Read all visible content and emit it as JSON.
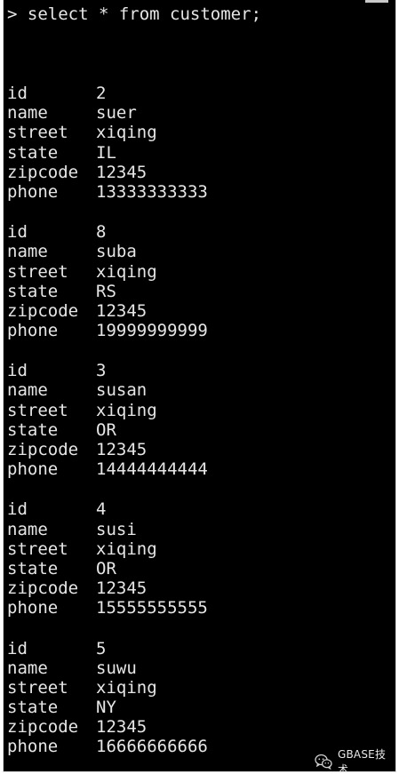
{
  "terminal": {
    "prompt": ">",
    "command": "select * from customer;"
  },
  "records": [
    {
      "fields": [
        {
          "key": "id",
          "value": "2"
        },
        {
          "key": "name",
          "value": "suer"
        },
        {
          "key": "street",
          "value": "xiqing"
        },
        {
          "key": "state",
          "value": "IL"
        },
        {
          "key": "zipcode",
          "value": "12345"
        },
        {
          "key": "phone",
          "value": "13333333333"
        }
      ]
    },
    {
      "fields": [
        {
          "key": "id",
          "value": "8"
        },
        {
          "key": "name",
          "value": "suba"
        },
        {
          "key": "street",
          "value": "xiqing"
        },
        {
          "key": "state",
          "value": "RS"
        },
        {
          "key": "zipcode",
          "value": "12345"
        },
        {
          "key": "phone",
          "value": "19999999999"
        }
      ]
    },
    {
      "fields": [
        {
          "key": "id",
          "value": "3"
        },
        {
          "key": "name",
          "value": "susan"
        },
        {
          "key": "street",
          "value": "xiqing"
        },
        {
          "key": "state",
          "value": "OR"
        },
        {
          "key": "zipcode",
          "value": "12345"
        },
        {
          "key": "phone",
          "value": "14444444444"
        }
      ]
    },
    {
      "fields": [
        {
          "key": "id",
          "value": "4"
        },
        {
          "key": "name",
          "value": "susi"
        },
        {
          "key": "street",
          "value": "xiqing"
        },
        {
          "key": "state",
          "value": "OR"
        },
        {
          "key": "zipcode",
          "value": "12345"
        },
        {
          "key": "phone",
          "value": "15555555555"
        }
      ]
    },
    {
      "fields": [
        {
          "key": "id",
          "value": "5"
        },
        {
          "key": "name",
          "value": "suwu"
        },
        {
          "key": "street",
          "value": "xiqing"
        },
        {
          "key": "state",
          "value": "NY"
        },
        {
          "key": "zipcode",
          "value": "12345"
        },
        {
          "key": "phone",
          "value": "16666666666"
        }
      ]
    }
  ],
  "watermark": {
    "icon": "wechat-icon",
    "text": "GBASE技术"
  },
  "colors": {
    "background": "#000000",
    "text": "#e6e6e6",
    "frame": "#d8d8d8"
  }
}
